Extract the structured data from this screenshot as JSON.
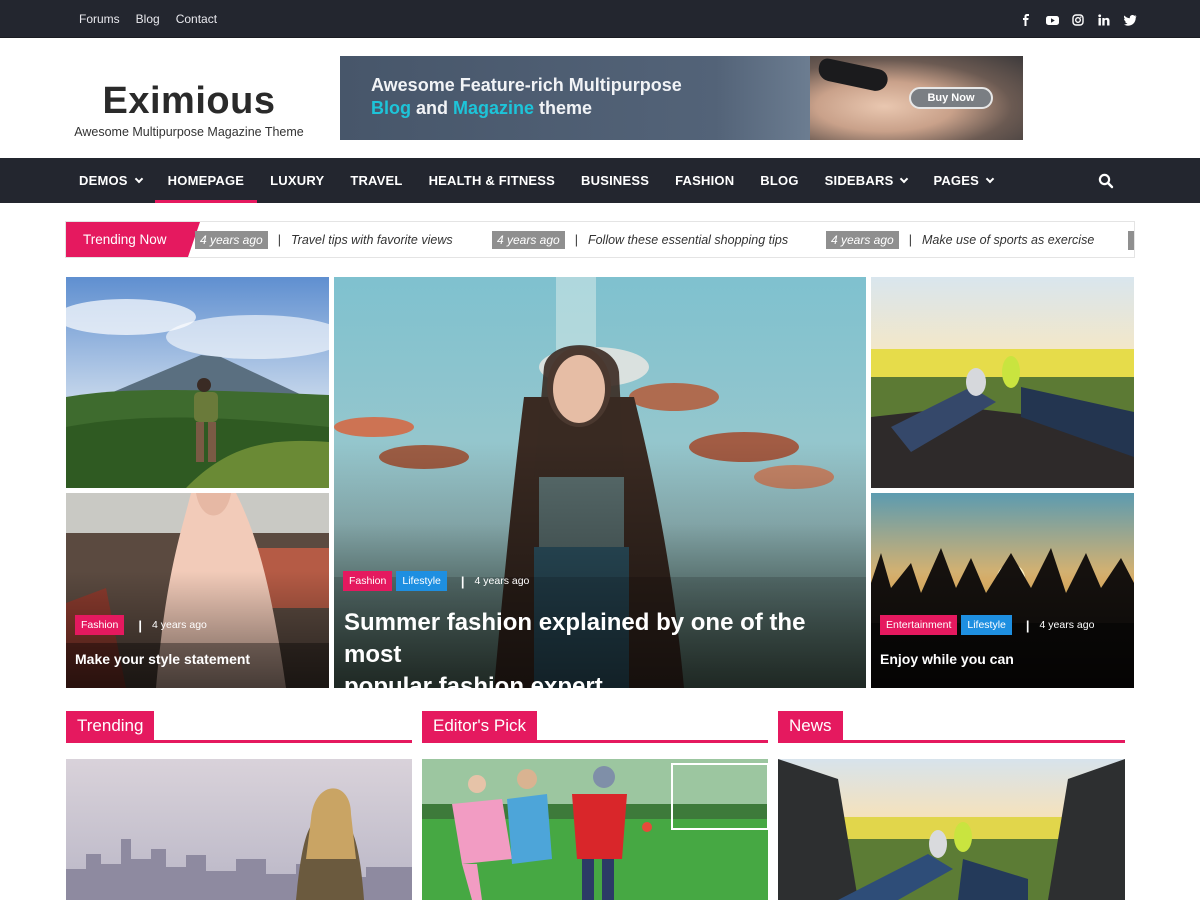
{
  "topbar": {
    "links": [
      "Forums",
      "Blog",
      "Contact"
    ],
    "social_icons": [
      "facebook-icon",
      "youtube-icon",
      "instagram-icon",
      "linkedin-icon",
      "twitter-icon"
    ]
  },
  "brand": {
    "title": "Eximious",
    "tagline": "Awesome Multipurpose Magazine Theme"
  },
  "banner": {
    "line1": "Awesome Feature-rich Multipurpose",
    "line2_a": "Blog",
    "line2_b": " and ",
    "line2_c": "Magazine",
    "line2_d": " theme",
    "button": "Buy Now"
  },
  "nav": {
    "items": [
      {
        "label": "DEMOS",
        "dropdown": true,
        "active": false
      },
      {
        "label": "HOMEPAGE",
        "dropdown": false,
        "active": true
      },
      {
        "label": "LUXURY",
        "dropdown": false,
        "active": false
      },
      {
        "label": "TRAVEL",
        "dropdown": false,
        "active": false
      },
      {
        "label": "HEALTH & FITNESS",
        "dropdown": false,
        "active": false
      },
      {
        "label": "BUSINESS",
        "dropdown": false,
        "active": false
      },
      {
        "label": "FASHION",
        "dropdown": false,
        "active": false
      },
      {
        "label": "BLOG",
        "dropdown": false,
        "active": false
      },
      {
        "label": "SIDEBARS",
        "dropdown": true,
        "active": false
      },
      {
        "label": "PAGES",
        "dropdown": true,
        "active": false
      }
    ],
    "search_icon": "search-icon"
  },
  "ticker": {
    "label": "Trending Now",
    "entries": [
      {
        "ago": "4 years ago",
        "text": "Travel tips with favorite views"
      },
      {
        "ago": "4 years ago",
        "text": "Follow these essential shopping tips"
      },
      {
        "ago": "4 years ago",
        "text": "Make use of sports as exercise"
      }
    ]
  },
  "posts": {
    "left_bottom": {
      "cats": [
        "Fashion"
      ],
      "ago": "4 years ago",
      "title": "Make your style statement"
    },
    "center": {
      "cats": [
        "Fashion",
        "Lifestyle"
      ],
      "ago": "4 years ago",
      "title_line1": "Summer fashion explained by one of the most",
      "title_line2": "popular fashion expert"
    },
    "right_bottom": {
      "cats": [
        "Entertainment",
        "Lifestyle"
      ],
      "ago": "4 years ago",
      "title": "Enjoy while you can"
    }
  },
  "sections": {
    "trending": "Trending",
    "editors_pick": "Editor's Pick",
    "news": "News"
  },
  "colors": {
    "accent": "#e5195f",
    "dark": "#23262f",
    "blue_tag": "#1e8fe1",
    "teal": "#1dc4d9"
  }
}
